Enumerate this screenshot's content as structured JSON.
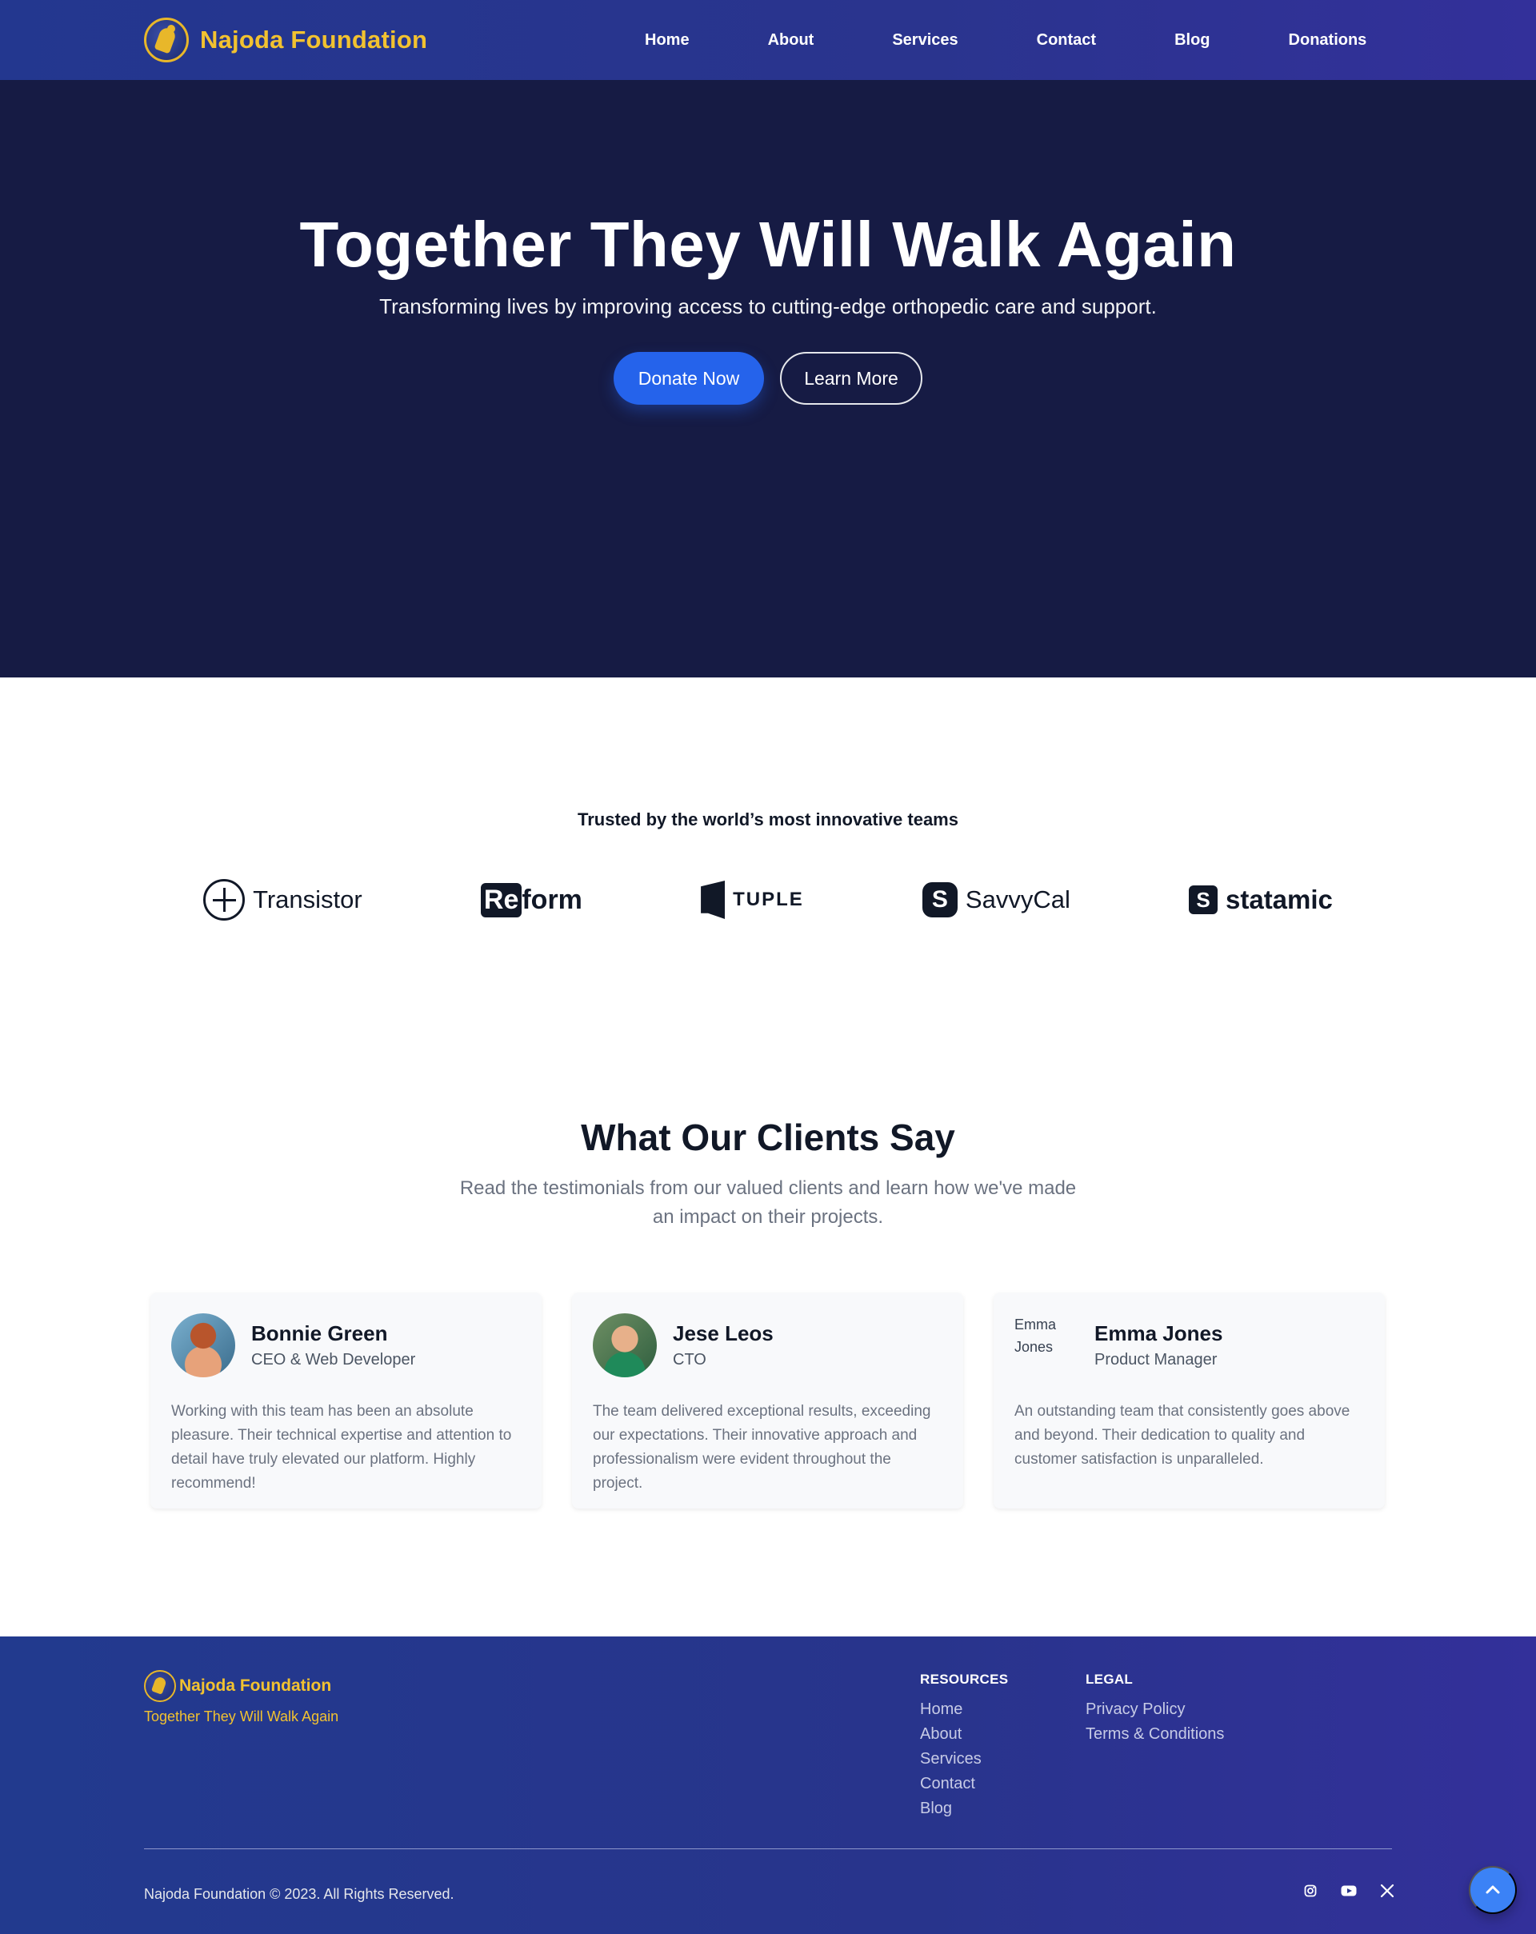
{
  "nav": {
    "brand": "Najoda Foundation",
    "links": [
      "Home",
      "About",
      "Services",
      "Contact",
      "Blog",
      "Donations"
    ]
  },
  "hero": {
    "title": "Together They Will Walk Again",
    "subtitle": "Transforming lives by improving access to cutting-edge orthopedic care and support.",
    "primary_button": "Donate Now",
    "secondary_button": "Learn More"
  },
  "trusted": {
    "title": "Trusted by the world’s most innovative teams",
    "logos": [
      {
        "name": "Transistor",
        "icon": "transistor-icon"
      },
      {
        "name": "Reform",
        "box": "Re",
        "text": "form",
        "icon": "reform-icon"
      },
      {
        "name": "TUPLE",
        "icon": "tuple-icon"
      },
      {
        "name": "SavvyCal",
        "glyph": "S",
        "icon": "savvycal-icon"
      },
      {
        "name": "statamic",
        "glyph": "S",
        "icon": "statamic-icon"
      }
    ]
  },
  "testimonials": {
    "title": "What Our Clients Say",
    "subtitle": "Read the testimonials from our valued clients and learn how we've made an impact on their projects.",
    "items": [
      {
        "name": "Bonnie Green",
        "role": "CEO & Web Developer",
        "quote": "Working with this team has been an absolute pleasure. Their technical expertise and attention to detail have truly elevated our platform. Highly recommend!"
      },
      {
        "name": "Jese Leos",
        "role": "CTO",
        "quote": "The team delivered exceptional results, exceeding our expectations. Their innovative approach and professionalism were evident throughout the project."
      },
      {
        "name": "Emma Jones",
        "role": "Product Manager",
        "avatar_alt": "Emma Jones",
        "quote": "An outstanding team that consistently goes above and beyond. Their dedication to quality and customer satisfaction is unparalleled."
      }
    ]
  },
  "footer": {
    "brand": "Najoda Foundation",
    "tagline": "Together They Will Walk Again",
    "resources_title": "RESOURCES",
    "resources": [
      "Home",
      "About",
      "Services",
      "Contact",
      "Blog"
    ],
    "legal_title": "LEGAL",
    "legal": [
      "Privacy Policy",
      "Terms & Conditions"
    ],
    "copyright": "Najoda Foundation © 2023. All Rights Reserved.",
    "social": [
      "instagram-icon",
      "youtube-icon",
      "x-icon"
    ]
  },
  "colors": {
    "nav_bg": "#23378f",
    "hero_bg": "#161b44",
    "brand_gold": "#f2c230",
    "primary_blue": "#2563eb",
    "scroll_button": "#3b82f6"
  }
}
